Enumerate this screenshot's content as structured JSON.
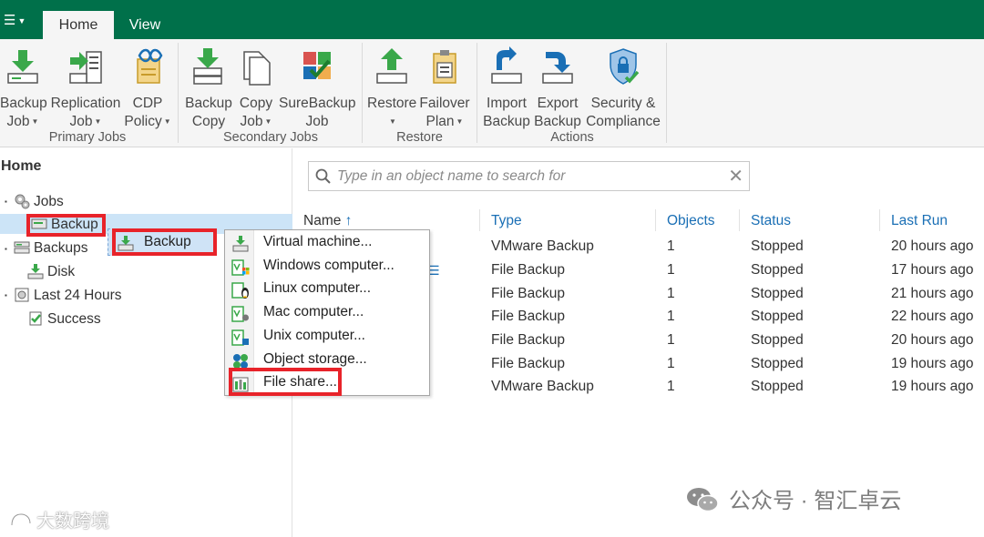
{
  "app": {
    "menu_icon": "hamburger-menu-icon",
    "tabs": [
      {
        "label": "Home"
      },
      {
        "label": "View"
      }
    ]
  },
  "ribbon": {
    "groups": {
      "primary_jobs": "Primary Jobs",
      "secondary_jobs": "Secondary Jobs",
      "restore": "Restore",
      "actions": "Actions"
    },
    "buttons": {
      "backup_job": {
        "line1": "Backup",
        "line2": "Job",
        "icon": "backup-job-icon"
      },
      "replication_job": {
        "line1": "Replication",
        "line2": "Job",
        "icon": "replication-job-icon"
      },
      "cdp_policy": {
        "line1": "CDP",
        "line2": "Policy",
        "icon": "cdp-policy-icon"
      },
      "backup_copy": {
        "line1": "Backup",
        "line2": "Copy",
        "icon": "backup-copy-icon"
      },
      "copy_job": {
        "line1": "Copy",
        "line2": "Job",
        "icon": "copy-job-icon"
      },
      "surebackup_job": {
        "line1": "SureBackup",
        "line2": "Job",
        "icon": "surebackup-job-icon"
      },
      "restore": {
        "line1": "Restore",
        "line2": "",
        "icon": "restore-icon"
      },
      "failover_plan": {
        "line1": "Failover",
        "line2": "Plan",
        "icon": "failover-plan-icon"
      },
      "import_backup": {
        "line1": "Import",
        "line2": "Backup",
        "icon": "import-backup-icon"
      },
      "export_backup": {
        "line1": "Export",
        "line2": "Backup",
        "icon": "export-backup-icon"
      },
      "security_compliance": {
        "line1": "Security &",
        "line2": "Compliance",
        "icon": "security-compliance-icon"
      }
    }
  },
  "nav": {
    "title": "Home",
    "items": {
      "jobs": "Jobs",
      "backup": "Backup",
      "backups": "Backups",
      "disk": "Disk",
      "last24": "Last 24 Hours",
      "success": "Success"
    }
  },
  "drag_ghost": {
    "label": "Backup"
  },
  "context_menu": {
    "items": [
      {
        "label": "Virtual machine...",
        "icon": "virtual-machine-icon"
      },
      {
        "label": "Windows computer...",
        "icon": "windows-computer-icon"
      },
      {
        "label": "Linux computer...",
        "icon": "linux-computer-icon"
      },
      {
        "label": "Mac computer...",
        "icon": "mac-computer-icon"
      },
      {
        "label": "Unix computer...",
        "icon": "unix-computer-icon"
      },
      {
        "label": "Object storage...",
        "icon": "object-storage-icon"
      },
      {
        "label": "File share...",
        "icon": "file-share-icon"
      }
    ]
  },
  "search": {
    "placeholder": "Type in an object name to search for"
  },
  "table": {
    "columns": {
      "name": "Name",
      "type": "Type",
      "objects": "Objects",
      "status": "Status",
      "last_run": "Last Run"
    },
    "sort_indicator": "↑",
    "rows": [
      {
        "type": "VMware Backup",
        "objects": "1",
        "status": "Stopped",
        "last_run": "20 hours ago"
      },
      {
        "type": "File Backup",
        "objects": "1",
        "status": "Stopped",
        "last_run": "17 hours ago"
      },
      {
        "type": "File Backup",
        "objects": "1",
        "status": "Stopped",
        "last_run": "21 hours ago"
      },
      {
        "type": "File Backup",
        "objects": "1",
        "status": "Stopped",
        "last_run": "22 hours ago"
      },
      {
        "type": "File Backup",
        "objects": "1",
        "status": "Stopped",
        "last_run": "20 hours ago"
      },
      {
        "type": "File Backup",
        "objects": "1",
        "status": "Stopped",
        "last_run": "19 hours ago"
      },
      {
        "type": "VMware Backup",
        "objects": "1",
        "status": "Stopped",
        "last_run": "19 hours ago"
      }
    ]
  },
  "watermarks": {
    "left": "大数跨境",
    "right": "公众号 · 智汇卓云"
  },
  "colors": {
    "titlebar": "#00704a",
    "accent_blue": "#1a6fb5",
    "selection": "#cce4f7",
    "highlight_red": "#e8232a",
    "icon_green": "#3aa84a"
  }
}
